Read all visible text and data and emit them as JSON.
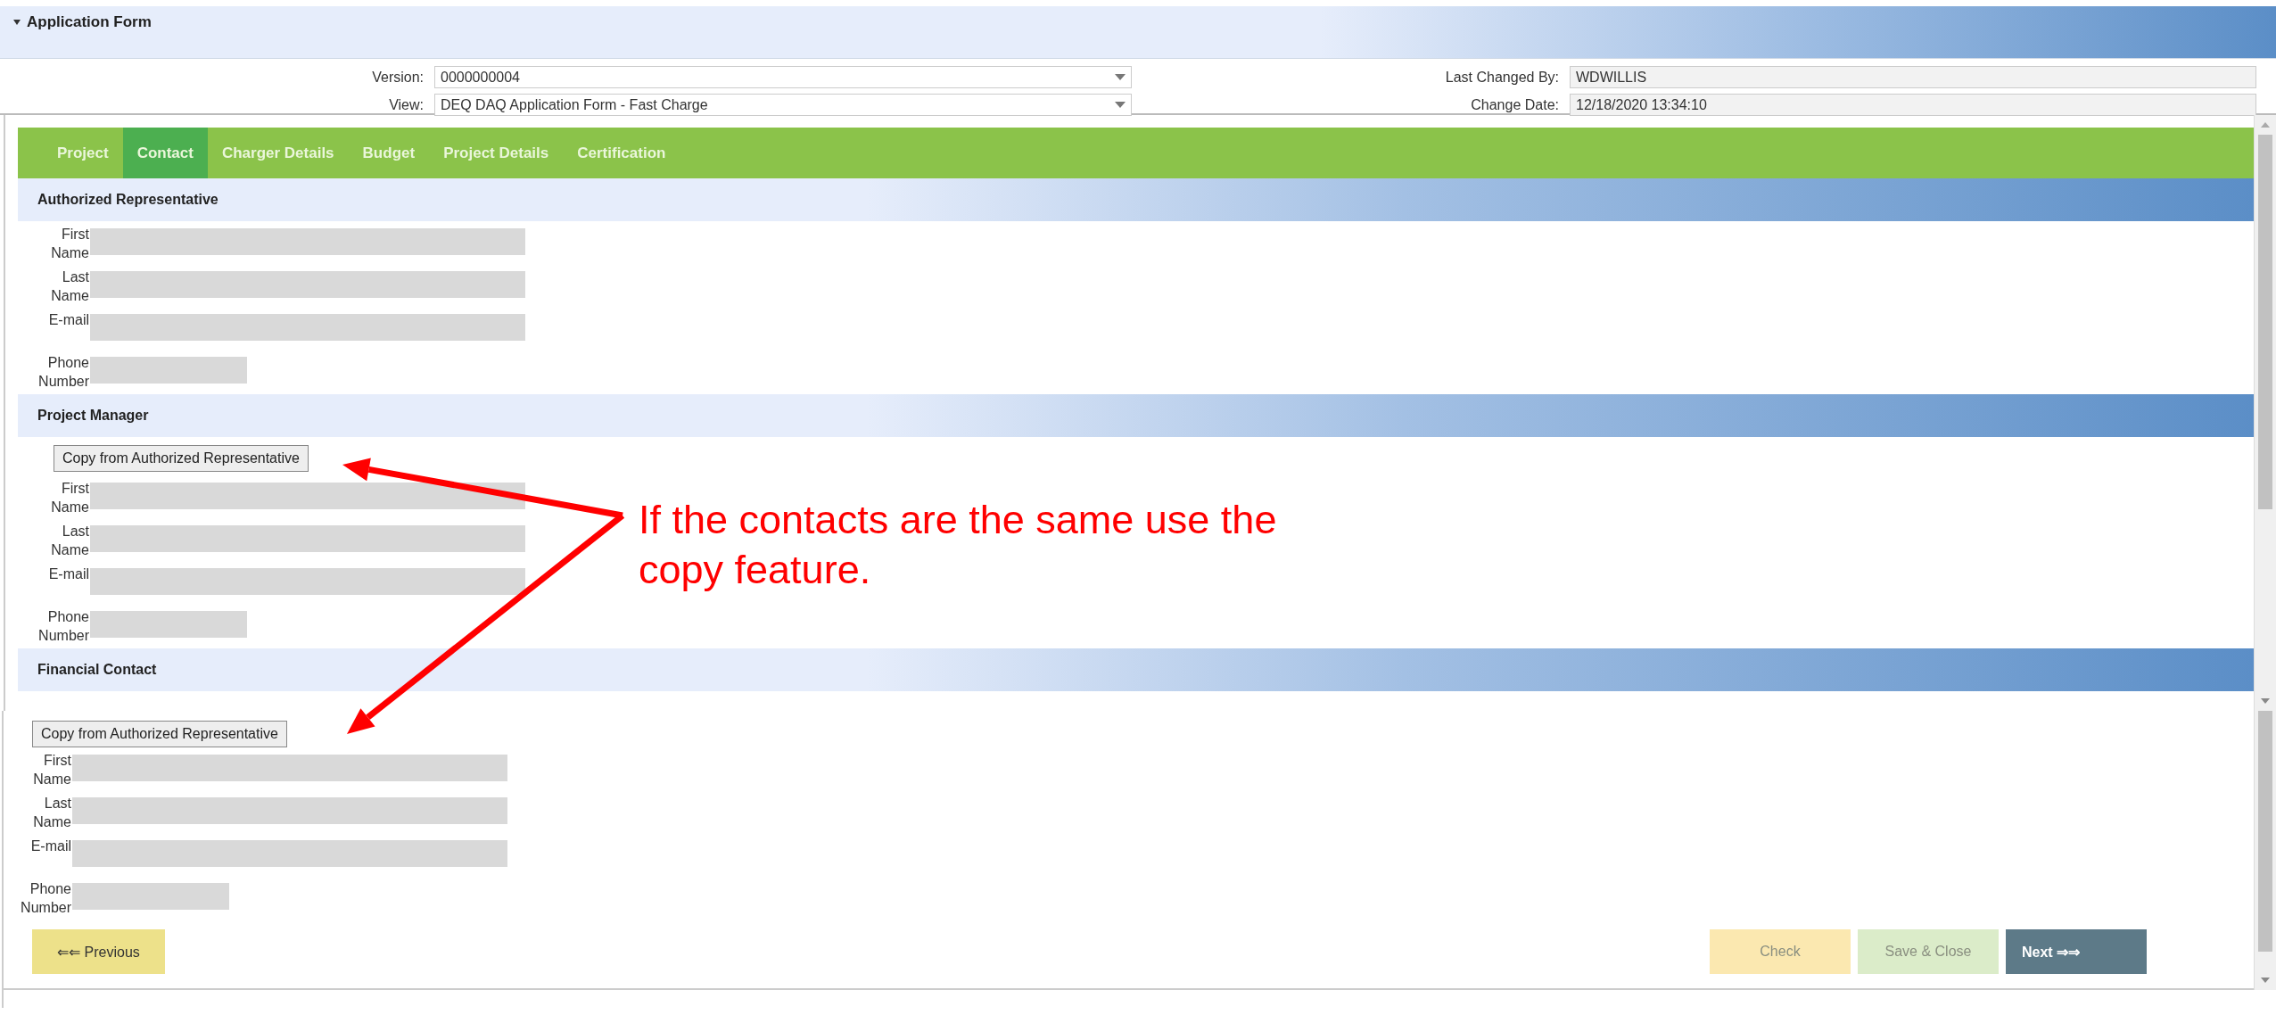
{
  "panel": {
    "title": "Application Form",
    "expanded": true
  },
  "meta_fields": [
    {
      "label": "Version:",
      "value": "0000000004",
      "kind": "dropdown"
    },
    {
      "label": "Last Changed By:",
      "value": "WDWILLIS",
      "kind": "readonly"
    },
    {
      "label": "View:",
      "value": "DEQ DAQ Application Form - Fast Charge",
      "kind": "dropdown"
    },
    {
      "label": "Change Date:",
      "value": "12/18/2020 13:34:10",
      "kind": "readonly"
    }
  ],
  "tabs": [
    {
      "label": "Project",
      "selected": false
    },
    {
      "label": "Contact",
      "selected": true
    },
    {
      "label": "Charger Details",
      "selected": false
    },
    {
      "label": "Budget",
      "selected": false
    },
    {
      "label": "Project Details",
      "selected": false
    },
    {
      "label": "Certification",
      "selected": false
    }
  ],
  "sections": [
    {
      "title": "Authorized Representative",
      "fields": [
        {
          "label": "First Name",
          "kind": "long"
        },
        {
          "label": "Last Name",
          "kind": "long"
        },
        {
          "label": "E-mail",
          "kind": "long"
        },
        {
          "label": "Phone Number",
          "kind": "short"
        }
      ]
    },
    {
      "title": "Project Manager",
      "copy_button": "Copy from Authorized Representative",
      "fields": [
        {
          "label": "First Name",
          "kind": "long"
        },
        {
          "label": "Last Name",
          "kind": "long"
        },
        {
          "label": "E-mail",
          "kind": "long"
        },
        {
          "label": "Phone Number",
          "kind": "short"
        }
      ]
    },
    {
      "title": "Financial Contact"
    }
  ],
  "lower_pane": {
    "copy_button": "Copy from Authorized Representative",
    "fields": [
      {
        "label": "First Name",
        "kind": "long"
      },
      {
        "label": "Last Name",
        "kind": "long"
      },
      {
        "label": "E-mail",
        "kind": "long"
      },
      {
        "label": "Phone Number",
        "kind": "short"
      }
    ]
  },
  "buttons": [
    {
      "label": "⇐⇐ Previous",
      "kind": "previous",
      "disabled": false
    },
    {
      "label": "Check",
      "kind": "check",
      "disabled": true
    },
    {
      "label": "Save & Close",
      "kind": "save",
      "disabled": true
    },
    {
      "label": "Next ⇒⇒",
      "kind": "next",
      "disabled": false
    }
  ],
  "annotation": {
    "text": "If the contacts are the same use the copy feature."
  }
}
